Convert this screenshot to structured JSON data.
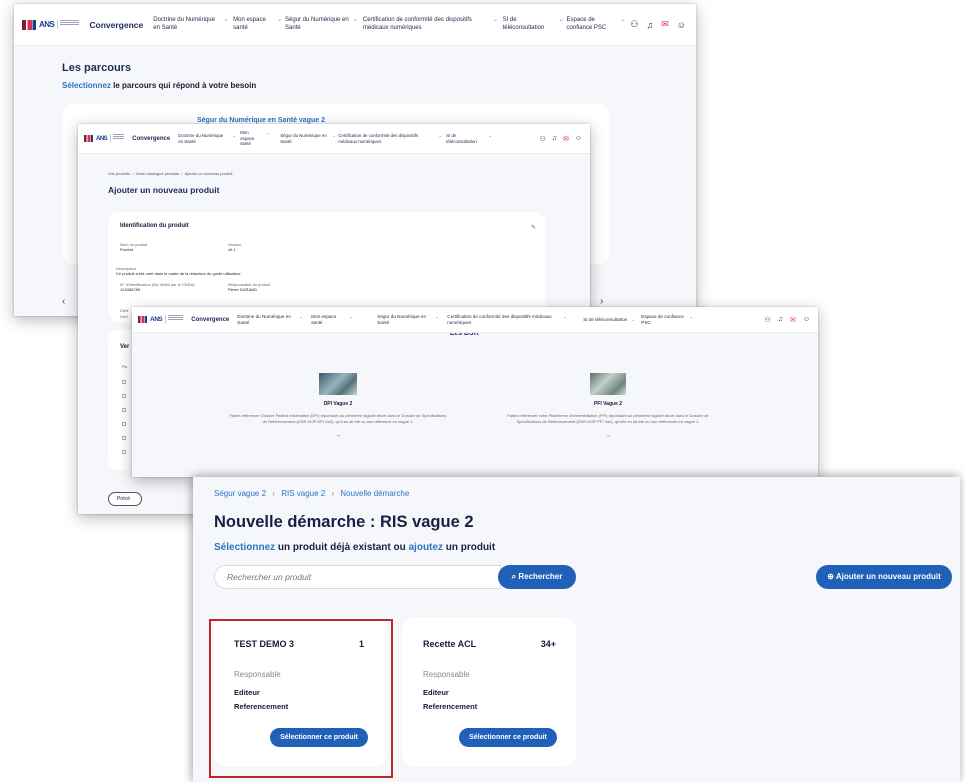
{
  "nav": {
    "brand": "Convergence",
    "items": [
      "Doctrine du Numérique en Santé",
      "Mon espace santé",
      "Ségur du Numérique en Santé",
      "Certification de conformité des dispositifs médicaux numériques",
      "SI de téléconsultation",
      "Espace de confiance PSC"
    ],
    "logo_text": "ANS"
  },
  "shot1": {
    "title": "Les parcours",
    "subtitle_highlight": "Sélectionnez",
    "subtitle_rest": "le parcours qui répond à votre besoin",
    "card_label": "Ségur du Numérique en Santé vague 2",
    "prev_arrow": "‹",
    "next_arrow": "›"
  },
  "shot2": {
    "breadcrumb": [
      "Vos produits",
      "Votre catalogue produits",
      "Ajouter un nouveau produit"
    ],
    "title": "Ajouter un nouveau produit",
    "section_title": "Identification du produit",
    "fields": [
      {
        "label": "Nom du produit",
        "value": "Produit"
      },
      {
        "label": "Version",
        "value": "v0.1"
      },
      {
        "label": "Description",
        "value": "Ce produit a été créé dans le cadre de la rédaction du guide utilisateur."
      },
      {
        "label": "N° d'identification (Nic défini par le CNDA)",
        "value": "123456789"
      },
      {
        "label": "Responsable du produit",
        "value": "Pierre DURAND"
      }
    ],
    "cut_labels": [
      "Certi",
      "Cert",
      "Ver",
      "Pa",
      "Précé"
    ]
  },
  "shot3": {
    "heading_cut": "Les DSR",
    "items": [
      {
        "title": "DPI Vague 2",
        "desc": "Faites référencer Dossier Patient Informatisé (DPI) répondant au périmètre logiciel décrit dans le Dossier de Spécifications de Référencement (DSR-HOP DPI Va2), qu'il en ait été ou non référencé en vague 1."
      },
      {
        "title": "PFI Vague 2",
        "desc": "Faites référencer votre Plateforme d'Intermédiation (PFI) répondant au périmètre logiciel décrit dans le Dossier de Spécifications de Référencement (DSR-HOP PFI Va2), qu'elle en ait été ou non référencée en vague 1."
      }
    ],
    "arrow": "→"
  },
  "shot4": {
    "breadcrumb": [
      "Ségur vague 2",
      "RIS vague 2",
      "Nouvelle démarche"
    ],
    "separator": "›",
    "title": "Nouvelle démarche : RIS vague 2",
    "subtitle": {
      "sel": "Sélectionnez",
      "mid": "un produit déjà existant ou",
      "add": "ajoutez",
      "end": "un produit"
    },
    "search_placeholder": "Rechercher un produit",
    "search_button": "Rechercher",
    "add_button": "Ajouter un nouveau produit",
    "products": [
      {
        "name": "TEST DEMO 3",
        "count": "1",
        "role": "Responsable",
        "lines": [
          "Editeur",
          "Referencement"
        ],
        "button": "Sélectionner ce produit",
        "highlighted": true
      },
      {
        "name": "Recette ACL",
        "count": "34+",
        "role": "Responsable",
        "lines": [
          "Editeur",
          "Referencement"
        ],
        "button": "Sélectionner ce produit",
        "highlighted": false
      }
    ]
  },
  "colors": {
    "accent_blue": "#2060b8",
    "link_blue": "#2d73c8",
    "highlight_red": "#c0272d",
    "logo_red": "#d9314f"
  },
  "icons": [
    "users-icon",
    "bell-icon",
    "mail-icon",
    "user-icon",
    "search-icon",
    "plus-circle-icon",
    "edit-icon",
    "arrow-right-icon"
  ]
}
